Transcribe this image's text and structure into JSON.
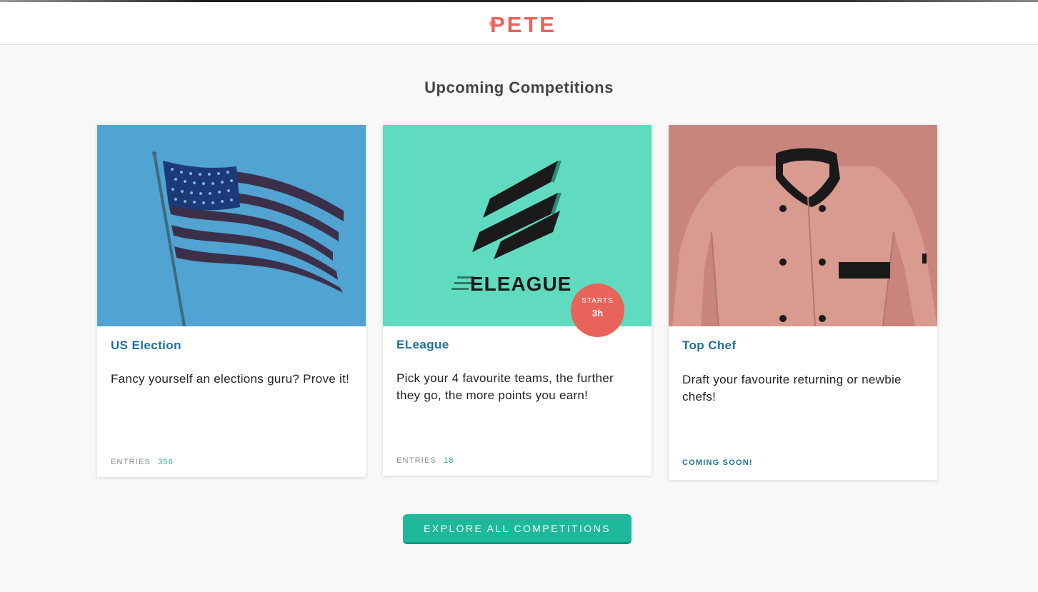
{
  "header": {
    "logo_text": "PETE"
  },
  "page": {
    "title": "Upcoming Competitions"
  },
  "colors": {
    "accent": "#1db99a",
    "brand": "#e8635a",
    "title_blue": "#1f6fa0"
  },
  "competitions": [
    {
      "title": "US Election",
      "description": "Fancy yourself an elections guru? Prove it!",
      "entries_label": "ENTRIES",
      "entries": "356",
      "image": "us-flag"
    },
    {
      "title": "ELeague",
      "description": "Pick your 4 favourite teams, the further they go, the more points you earn!",
      "entries_label": "ENTRIES",
      "entries": "18",
      "image": "eleague-logo",
      "badge": {
        "label": "STARTS",
        "value": "3h"
      },
      "image_text": "ELEAGUE"
    },
    {
      "title": "Top Chef",
      "description": "Draft your favourite returning or newbie chefs!",
      "status": "COMING SOON!",
      "image": "chef-jacket"
    }
  ],
  "explore_button": {
    "label": "EXPLORE ALL COMPETITIONS"
  }
}
